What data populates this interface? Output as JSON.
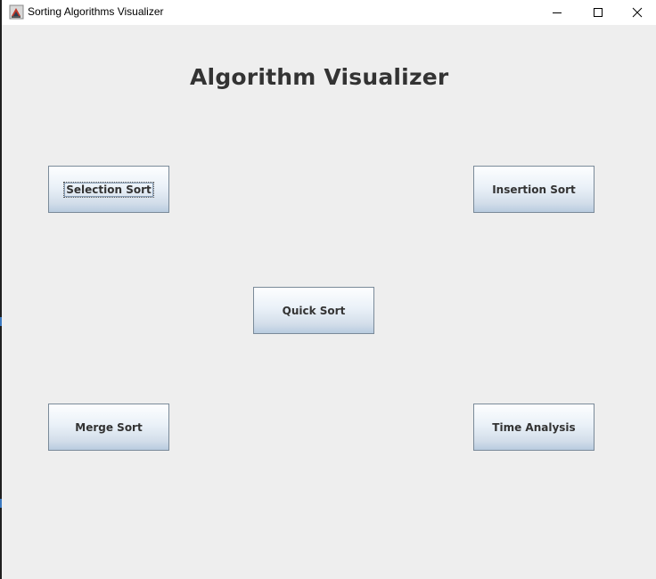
{
  "window": {
    "title": "Sorting Algorithms Visualizer",
    "app_icon": "java-app-icon",
    "controls": {
      "minimize_icon": "minimize-icon",
      "maximize_icon": "maximize-icon",
      "close_icon": "close-icon"
    }
  },
  "main": {
    "heading": "Algorithm Visualizer",
    "buttons": {
      "selection_sort": "Selection Sort",
      "insertion_sort": "Insertion Sort",
      "quick_sort": "Quick Sort",
      "merge_sort": "Merge Sort",
      "time_analysis": "Time Analysis"
    },
    "focused_button": "Selection Sort"
  },
  "colors": {
    "background": "#eeeeee",
    "heading": "#333333",
    "button_border": "#7a8a99",
    "button_gradient_bottom": "#b8cbdf"
  }
}
